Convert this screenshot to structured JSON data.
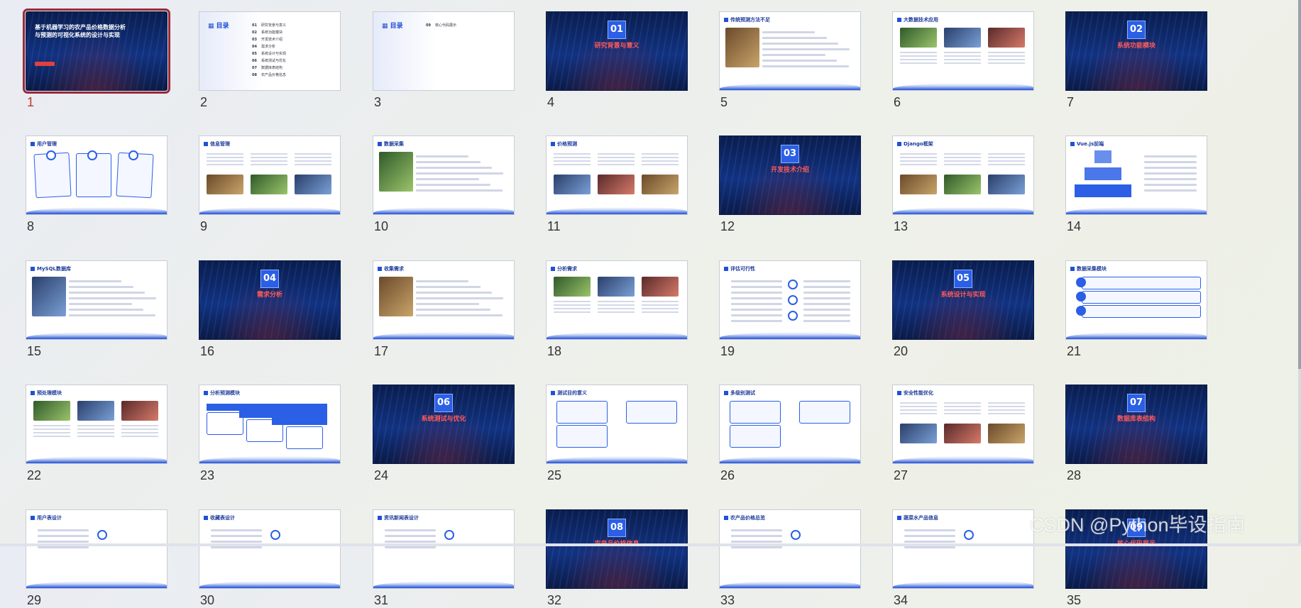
{
  "watermark": "CSDN @Python毕设指南",
  "slides": [
    {
      "n": "1",
      "type": "cover",
      "title": "基于机器学习的农产品价格数据分析与预测的可视化系统的设计与实现"
    },
    {
      "n": "2",
      "type": "toc",
      "title": "目录",
      "items": [
        "研究背景与意义",
        "系统功能模块",
        "开发技术介绍",
        "需求分析",
        "系统设计与实现",
        "系统测试与优化",
        "数据库表结构",
        "农产品价格信息"
      ],
      "nums": [
        "01",
        "02",
        "03",
        "04",
        "05",
        "06",
        "07",
        "08"
      ]
    },
    {
      "n": "3",
      "type": "toc2",
      "title": "目录",
      "items": [
        "核心代码展示"
      ],
      "nums": [
        "09"
      ]
    },
    {
      "n": "4",
      "type": "section",
      "num": "01",
      "title": "研究背景与意义"
    },
    {
      "n": "5",
      "type": "content",
      "title": "传统预测方法不足"
    },
    {
      "n": "6",
      "type": "content3",
      "title": "大数据技术应用"
    },
    {
      "n": "7",
      "type": "section",
      "num": "02",
      "title": "系统功能模块"
    },
    {
      "n": "8",
      "type": "boxes",
      "title": "用户管理"
    },
    {
      "n": "9",
      "type": "content3",
      "title": "信息管理"
    },
    {
      "n": "10",
      "type": "content",
      "title": "数据采集"
    },
    {
      "n": "11",
      "type": "content3",
      "title": "价格预测"
    },
    {
      "n": "12",
      "type": "section",
      "num": "03",
      "title": "开发技术介绍"
    },
    {
      "n": "13",
      "type": "content3",
      "title": "Django框架"
    },
    {
      "n": "14",
      "type": "pyramid",
      "title": "Vue.js前端"
    },
    {
      "n": "15",
      "type": "content",
      "title": "MySQL数据库"
    },
    {
      "n": "16",
      "type": "section",
      "num": "04",
      "title": "需求分析"
    },
    {
      "n": "17",
      "type": "content",
      "title": "收集需求"
    },
    {
      "n": "18",
      "type": "content3",
      "title": "分析需求"
    },
    {
      "n": "19",
      "type": "circles",
      "title": "评估可行性"
    },
    {
      "n": "20",
      "type": "section",
      "num": "05",
      "title": "系统设计与实现"
    },
    {
      "n": "21",
      "type": "list",
      "title": "数据采集模块"
    },
    {
      "n": "22",
      "type": "content3",
      "title": "预处理模块"
    },
    {
      "n": "23",
      "type": "arrows",
      "title": "分析预测模块"
    },
    {
      "n": "24",
      "type": "section",
      "num": "06",
      "title": "系统测试与优化"
    },
    {
      "n": "25",
      "type": "flow",
      "title": "测试目的意义"
    },
    {
      "n": "26",
      "type": "boxes2",
      "title": "多级别测试"
    },
    {
      "n": "27",
      "type": "content3",
      "title": "安全性能优化"
    },
    {
      "n": "28",
      "type": "section",
      "num": "07",
      "title": "数据库表结构"
    },
    {
      "n": "29",
      "type": "partial",
      "title": "用户表设计"
    },
    {
      "n": "30",
      "type": "partial",
      "title": "收藏表设计"
    },
    {
      "n": "31",
      "type": "partial",
      "title": "资讯新闻表设计"
    },
    {
      "n": "32",
      "type": "section-partial",
      "num": "08",
      "title": "农产品价格信息"
    },
    {
      "n": "33",
      "type": "partial",
      "title": "农产品价格总览"
    },
    {
      "n": "34",
      "type": "partial",
      "title": "蔬菜水产品信息"
    },
    {
      "n": "35",
      "type": "section-partial",
      "num": "09",
      "title": "核心代码展示"
    }
  ]
}
